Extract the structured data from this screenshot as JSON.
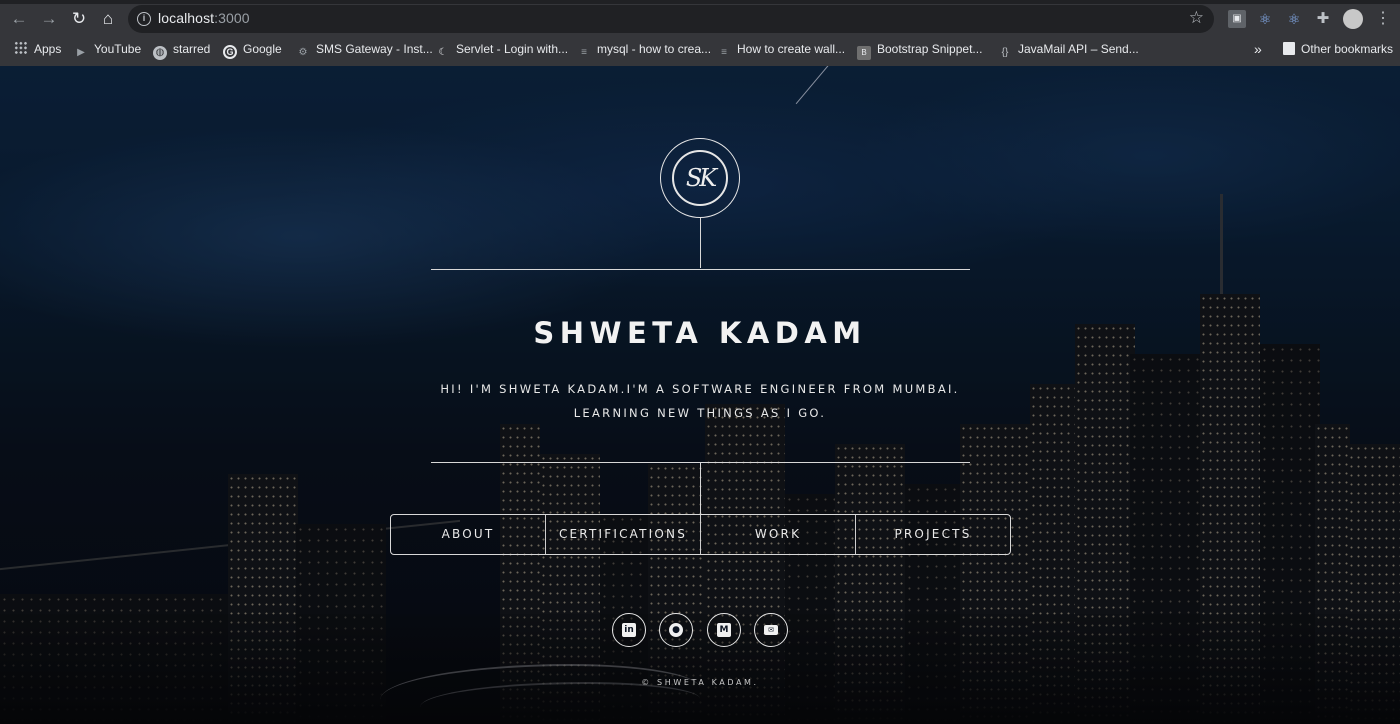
{
  "browser": {
    "url_host": "localhost",
    "url_port": ":3000",
    "bookmarks": [
      {
        "label": "Apps"
      },
      {
        "label": "YouTube"
      },
      {
        "label": "starred"
      },
      {
        "label": "Google"
      },
      {
        "label": "SMS Gateway - Inst..."
      },
      {
        "label": "Servlet - Login with..."
      },
      {
        "label": "mysql - how to crea..."
      },
      {
        "label": "How to create wall..."
      },
      {
        "label": "Bootstrap Snippet..."
      },
      {
        "label": "JavaMail API – Send..."
      }
    ],
    "overflow": "»",
    "other_bookmarks": "Other bookmarks"
  },
  "hero": {
    "logo_text": "SK",
    "name": "SHWETA KADAM",
    "intro_line1": "HI! I'M SHWETA KADAM.I'M A SOFTWARE ENGINEER FROM MUMBAI.",
    "intro_line2": "LEARNING NEW THINGS AS I GO."
  },
  "nav": {
    "items": [
      {
        "label": "ABOUT"
      },
      {
        "label": "CERTIFICATIONS"
      },
      {
        "label": "WORK"
      },
      {
        "label": "PROJECTS"
      }
    ]
  },
  "socials": [
    {
      "icon": "linkedin-icon",
      "glyph": "in"
    },
    {
      "icon": "github-icon",
      "glyph": "●"
    },
    {
      "icon": "medium-icon",
      "glyph": "M"
    },
    {
      "icon": "email-icon",
      "glyph": "✉"
    }
  ],
  "footer": {
    "text": "© SHWETA KADAM."
  },
  "colors": {
    "chrome_bg": "#35363a",
    "omnibox_bg": "#202124",
    "sky_top": "#0f2a4a",
    "text_light": "#f2f2f2"
  }
}
